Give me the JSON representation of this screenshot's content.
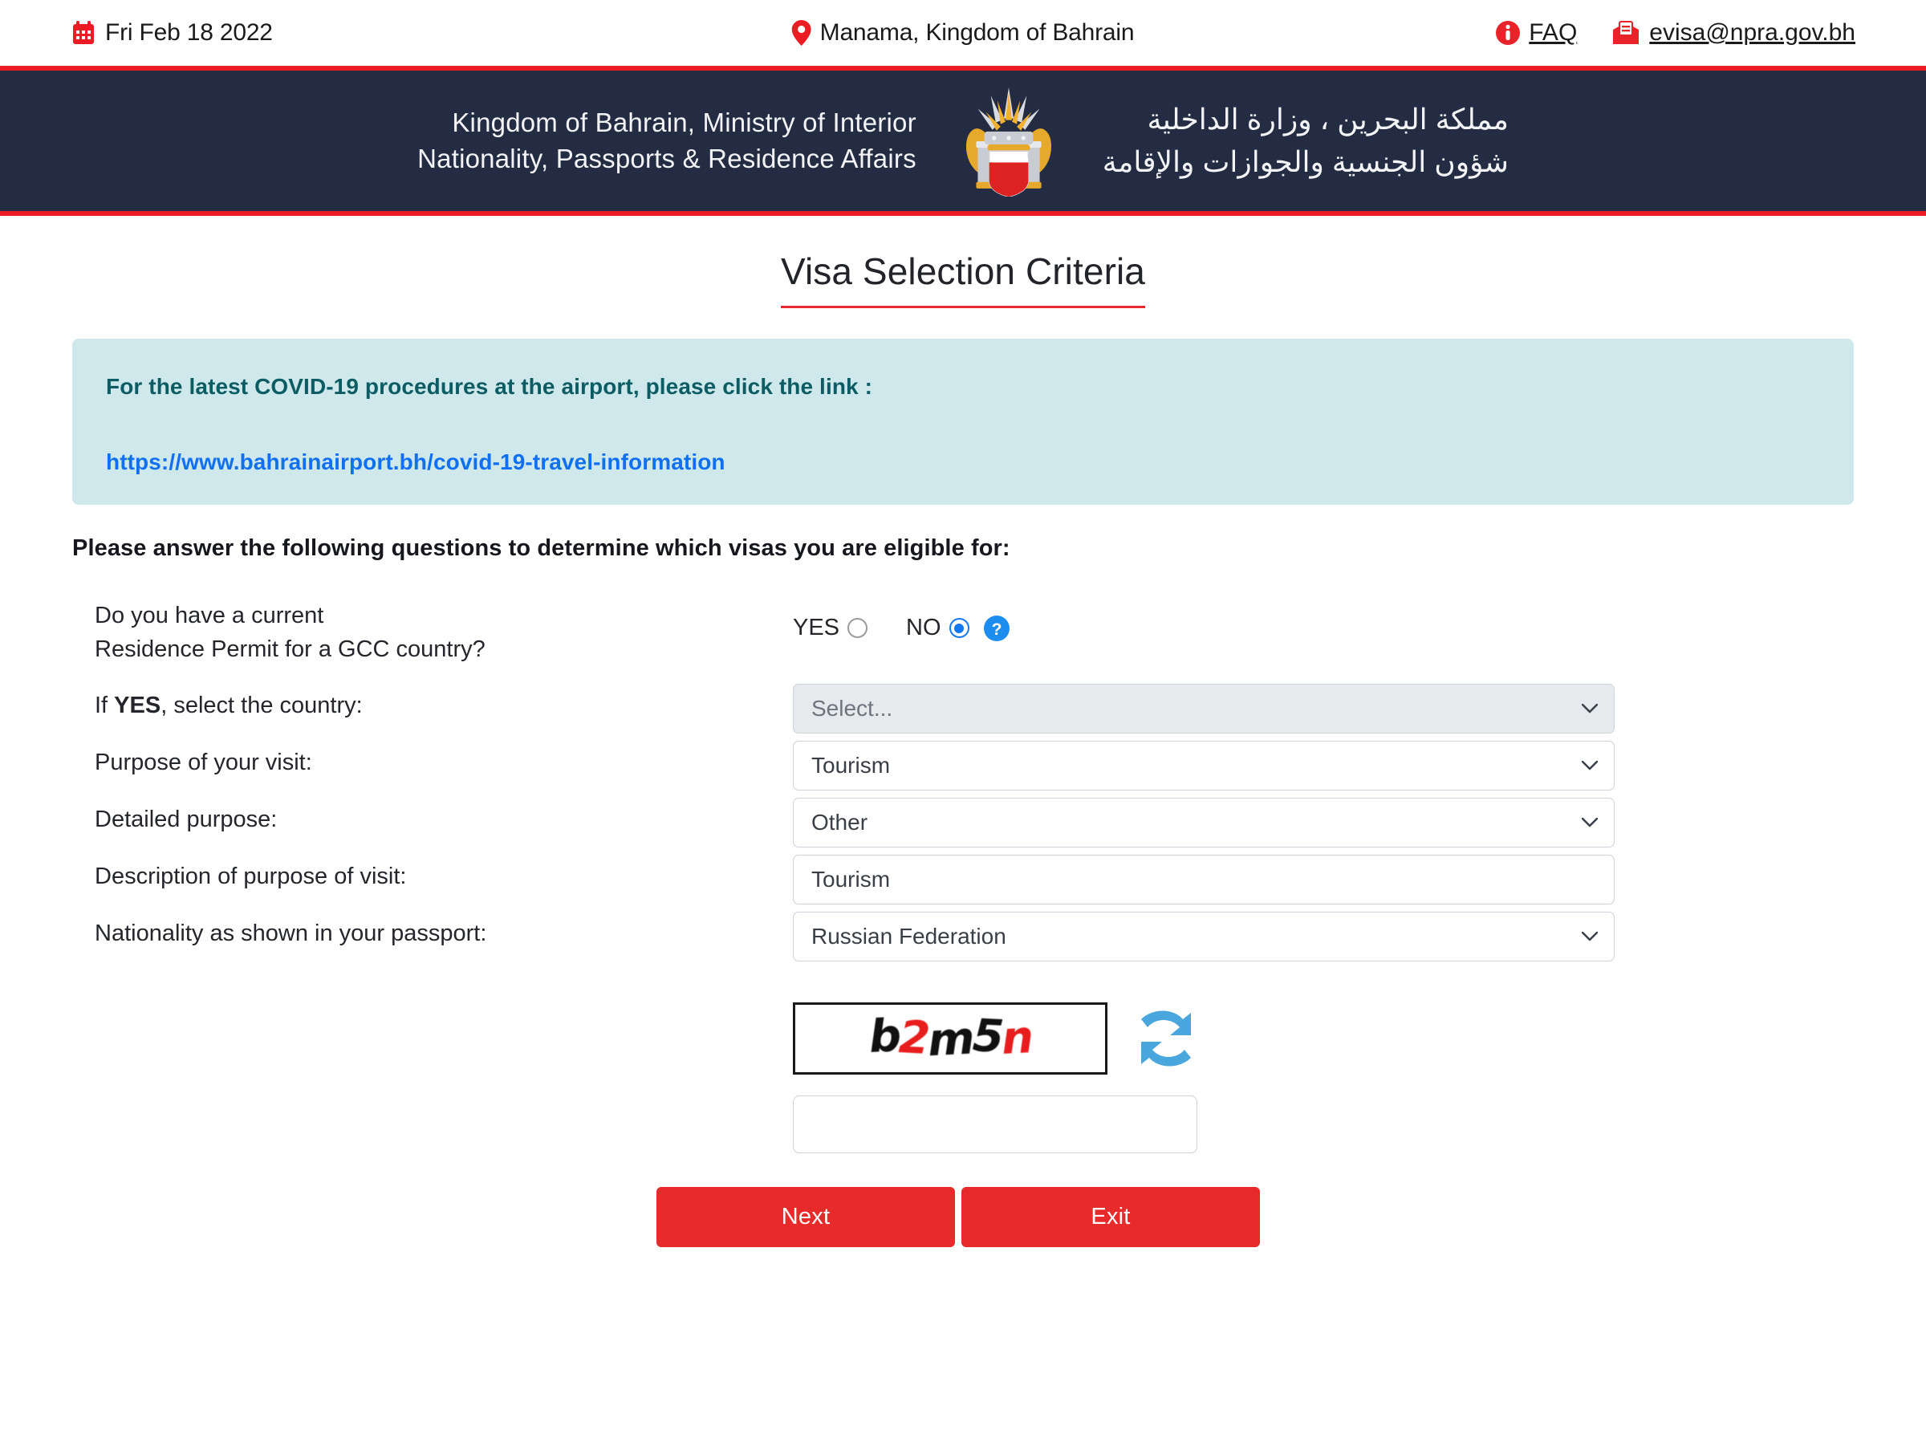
{
  "topbar": {
    "date": "Fri Feb 18 2022",
    "date_icon": "calendar-icon",
    "location": "Manama, Kingdom of Bahrain",
    "location_icon": "map-pin-icon",
    "faq_label": "FAQ",
    "faq_icon": "info-circle-icon",
    "email": "evisa@npra.gov.bh",
    "email_icon": "envelope-icon"
  },
  "banner": {
    "english_line1": "Kingdom of Bahrain, Ministry of Interior",
    "english_line2": "Nationality, Passports & Residence Affairs",
    "arabic_line1": "مملكة البحرين ، وزارة الداخلية",
    "arabic_line2": "شؤون الجنسية والجوازات والإقامة",
    "emblem_icon": "bahrain-coat-of-arms-icon",
    "bg_color": "#232c42",
    "rule_color": "#ec1c24"
  },
  "page": {
    "title": "Visa Selection Criteria",
    "title_underline_color": "#e8282f"
  },
  "notice": {
    "heading": "For the latest COVID-19 procedures at the airport, please click the link :",
    "link": "https://www.bahrainairport.bh/covid-19-travel-information",
    "bg_color": "#cfe8ec",
    "heading_color": "#0c5c63",
    "link_color": "#1170ef"
  },
  "form": {
    "lead": "Please answer the following questions to determine which visas you are eligible for:",
    "gcc_question_line1": "Do you have a current",
    "gcc_question_line2": "Residence Permit for a GCC country?",
    "yes_label": "YES",
    "no_label": "NO",
    "yes_selected": false,
    "no_selected": true,
    "help_icon": "question-mark-circle-icon",
    "country_label_prefix": "If ",
    "country_label_bold": "YES",
    "country_label_suffix": ", select the country:",
    "country_value": "Select...",
    "country_disabled": true,
    "purpose_label": "Purpose of your visit:",
    "purpose_value": "Tourism",
    "detailed_label": "Detailed purpose:",
    "detailed_value": "Other",
    "description_label": "Description of purpose of visit:",
    "description_value": "Tourism",
    "nationality_label": "Nationality as shown in your passport:",
    "nationality_value": "Russian Federation"
  },
  "captcha": {
    "code": "b2m5n",
    "char_colors": [
      "#111111",
      "#e81d1d",
      "#111111",
      "#111111",
      "#e81d1d"
    ],
    "refresh_icon": "refresh-arrows-icon",
    "input_value": ""
  },
  "buttons": {
    "next": "Next",
    "exit": "Exit",
    "color": "#e72b2b"
  }
}
